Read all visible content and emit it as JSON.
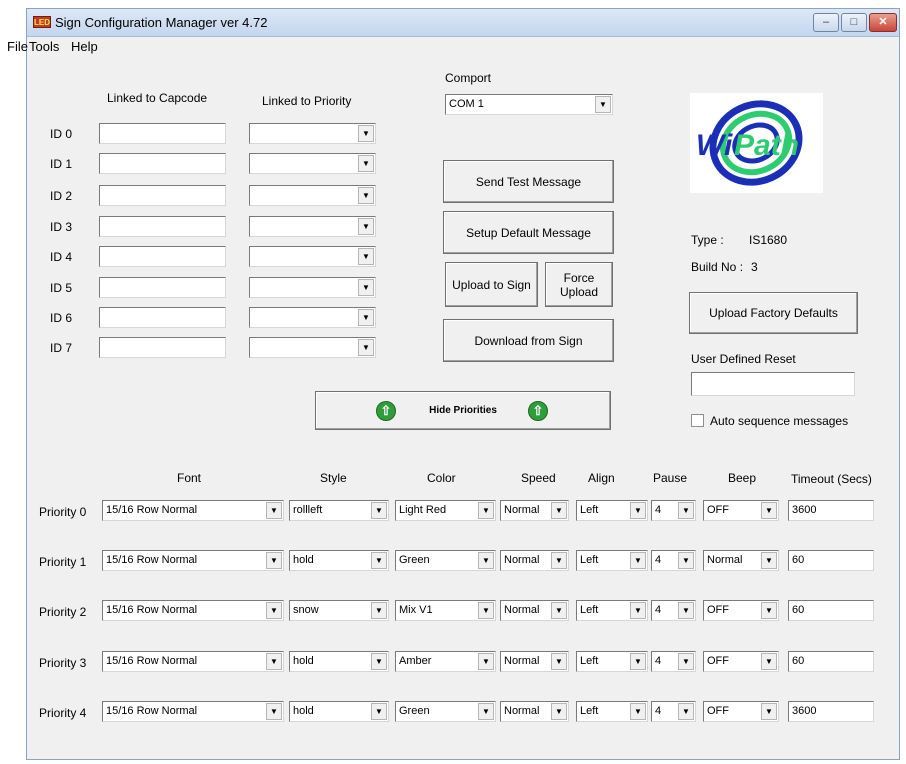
{
  "window": {
    "title": "Sign Configuration Manager ver 4.72",
    "app_icon": "LED"
  },
  "menu": [
    "File",
    "Tools",
    "Help"
  ],
  "ids": {
    "linked_capcode_header": "Linked to Capcode",
    "linked_priority_header": "Linked to Priority",
    "rows": [
      "ID 0",
      "ID 1",
      "ID 2",
      "ID 3",
      "ID 4",
      "ID 5",
      "ID 6",
      "ID 7"
    ]
  },
  "comport": {
    "label": "Comport",
    "value": "COM 1"
  },
  "buttons": {
    "send_test": "Send Test Message",
    "setup_default": "Setup Default Message",
    "upload_to_sign": "Upload to Sign",
    "force_upload_1": "Force",
    "force_upload_2": "Upload",
    "download_from_sign": "Download from Sign",
    "hide_priorities": "Hide Priorities",
    "upload_factory_defaults": "Upload Factory Defaults"
  },
  "logo": {
    "text_wi": "Wi",
    "text_path": "Path"
  },
  "info": {
    "type_label": "Type :",
    "type_value": "IS1680",
    "build_label": "Build No :",
    "build_value": "3"
  },
  "user_reset": {
    "label": "User Defined Reset",
    "value": ""
  },
  "auto_sequence": {
    "label": "Auto sequence messages",
    "checked": false
  },
  "priority_headers": {
    "font": "Font",
    "style": "Style",
    "color": "Color",
    "speed": "Speed",
    "align": "Align",
    "pause": "Pause",
    "beep": "Beep",
    "timeout": "Timeout (Secs)"
  },
  "priorities": [
    {
      "label": "Priority 0",
      "font": "15/16 Row Normal",
      "style": "rollleft",
      "color": "Light Red",
      "speed": "Normal",
      "align": "Left",
      "pause": "4",
      "beep": "OFF",
      "timeout": "3600"
    },
    {
      "label": "Priority 1",
      "font": "15/16 Row Normal",
      "style": "hold",
      "color": "Green",
      "speed": "Normal",
      "align": "Left",
      "pause": "4",
      "beep": "Normal",
      "timeout": "60"
    },
    {
      "label": "Priority 2",
      "font": "15/16 Row Normal",
      "style": "snow",
      "color": "Mix V1",
      "speed": "Normal",
      "align": "Left",
      "pause": "4",
      "beep": "OFF",
      "timeout": "60"
    },
    {
      "label": "Priority 3",
      "font": "15/16 Row Normal",
      "style": "hold",
      "color": "Amber",
      "speed": "Normal",
      "align": "Left",
      "pause": "4",
      "beep": "OFF",
      "timeout": "60"
    },
    {
      "label": "Priority 4",
      "font": "15/16 Row Normal",
      "style": "hold",
      "color": "Green",
      "speed": "Normal",
      "align": "Left",
      "pause": "4",
      "beep": "OFF",
      "timeout": "3600"
    }
  ]
}
